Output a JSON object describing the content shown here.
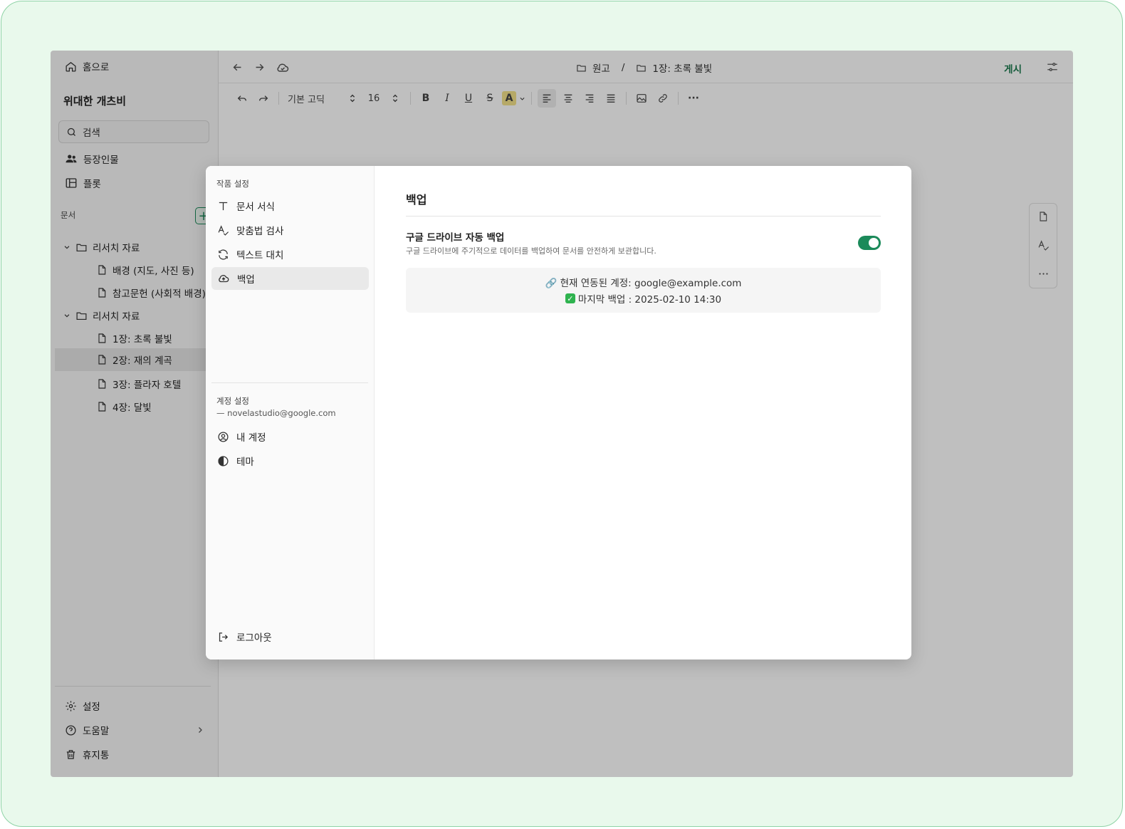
{
  "sidebar": {
    "home_label": "홈으로",
    "project_title": "위대한 개츠비",
    "search_placeholder": "검색",
    "nav": [
      {
        "label": "등장인물",
        "icon": "people-icon"
      },
      {
        "label": "플롯",
        "icon": "layout-icon"
      }
    ],
    "docs_label": "문서",
    "add_label": "+",
    "folders": [
      {
        "name": "리서치 자료",
        "items": [
          "배경 (지도, 사진 등)",
          "참고문헌 (사회적 배경)"
        ]
      },
      {
        "name": "리서치 자료",
        "items": [
          "1장: 초록 불빛",
          "2장: 재의 계곡",
          "3장: 플라자 호텔",
          "4장: 달빛"
        ]
      }
    ],
    "bottom": [
      {
        "label": "설정",
        "icon": "gear-icon"
      },
      {
        "label": "도움말",
        "icon": "help-icon"
      },
      {
        "label": "휴지통",
        "icon": "trash-icon"
      }
    ]
  },
  "topbar": {
    "breadcrumb": [
      "원고",
      "1장: 초록 불빛"
    ],
    "separator": "/",
    "publish_label": "게시"
  },
  "toolbar": {
    "font_family": "기본 고딕",
    "font_size": "16",
    "bold": "B",
    "italic": "I",
    "underline": "U",
    "strike": "S",
    "color": "A",
    "more": "···"
  },
  "modal": {
    "nav": {
      "work_settings_label": "작품 설정",
      "work_items": [
        {
          "label": "문서 서식",
          "icon": "text-icon"
        },
        {
          "label": "맞춤법 검사",
          "icon": "spellcheck-icon"
        },
        {
          "label": "텍스트 대치",
          "icon": "refresh-icon"
        },
        {
          "label": "백업",
          "icon": "cloud-upload-icon"
        }
      ],
      "account_settings_label": "계정 설정",
      "account_email": "— novelastudio@google.com",
      "account_items": [
        {
          "label": "내 계정",
          "icon": "user-circle-icon"
        },
        {
          "label": "테마",
          "icon": "theme-icon"
        }
      ],
      "logout_label": "로그아웃"
    },
    "content": {
      "title": "백업",
      "option_title": "구글 드라이브 자동 백업",
      "option_desc": "구글 드라이브에 주기적으로 데이터를 백업하여 문서를 안전하게 보관합니다.",
      "toggle_on": true,
      "linked_account": "🔗 현재 연동된 계정: google@example.com",
      "last_backup": "마지막 백업 : 2025-02-10 14:30"
    }
  },
  "colors": {
    "accent": "#1b8a5a",
    "frame_bg": "#e9f9ec"
  }
}
